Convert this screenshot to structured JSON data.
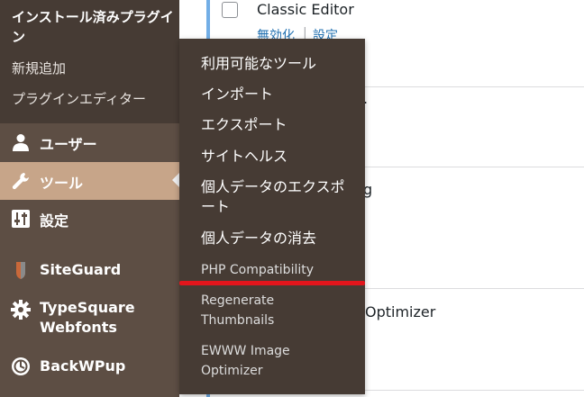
{
  "sidebar": {
    "submenu_title": "インストール済みプラグイン",
    "submenu_items": [
      "新規追加",
      "プラグインエディター"
    ],
    "menu": [
      {
        "label": "ユーザー",
        "icon": "user-icon"
      },
      {
        "label": "ツール",
        "icon": "wrench-icon",
        "active": true
      },
      {
        "label": "設定",
        "icon": "settings-icon"
      },
      {
        "label": "SiteGuard",
        "icon": "siteguard-icon"
      },
      {
        "label": "TypeSquare Webfonts",
        "icon": "gear-icon"
      },
      {
        "label": "BackWPup",
        "icon": "backwpup-icon"
      }
    ],
    "accent_color": "#c7a589"
  },
  "plugins": {
    "first": {
      "name": "Classic Editor",
      "deactivate_label": "無効化",
      "separator": "|",
      "settings_label": "設定"
    },
    "partial_names": [
      ".",
      "g",
      "Optimizer"
    ]
  },
  "flyout": {
    "items": [
      "利用可能なツール",
      "インポート",
      "エクスポート",
      "サイトヘルス",
      "個人データのエクスポート",
      "個人データの消去",
      "PHP Compatibility",
      "Regenerate Thumbnails",
      "EWWW Image Optimizer"
    ],
    "highlight_color": "#e2151c"
  }
}
